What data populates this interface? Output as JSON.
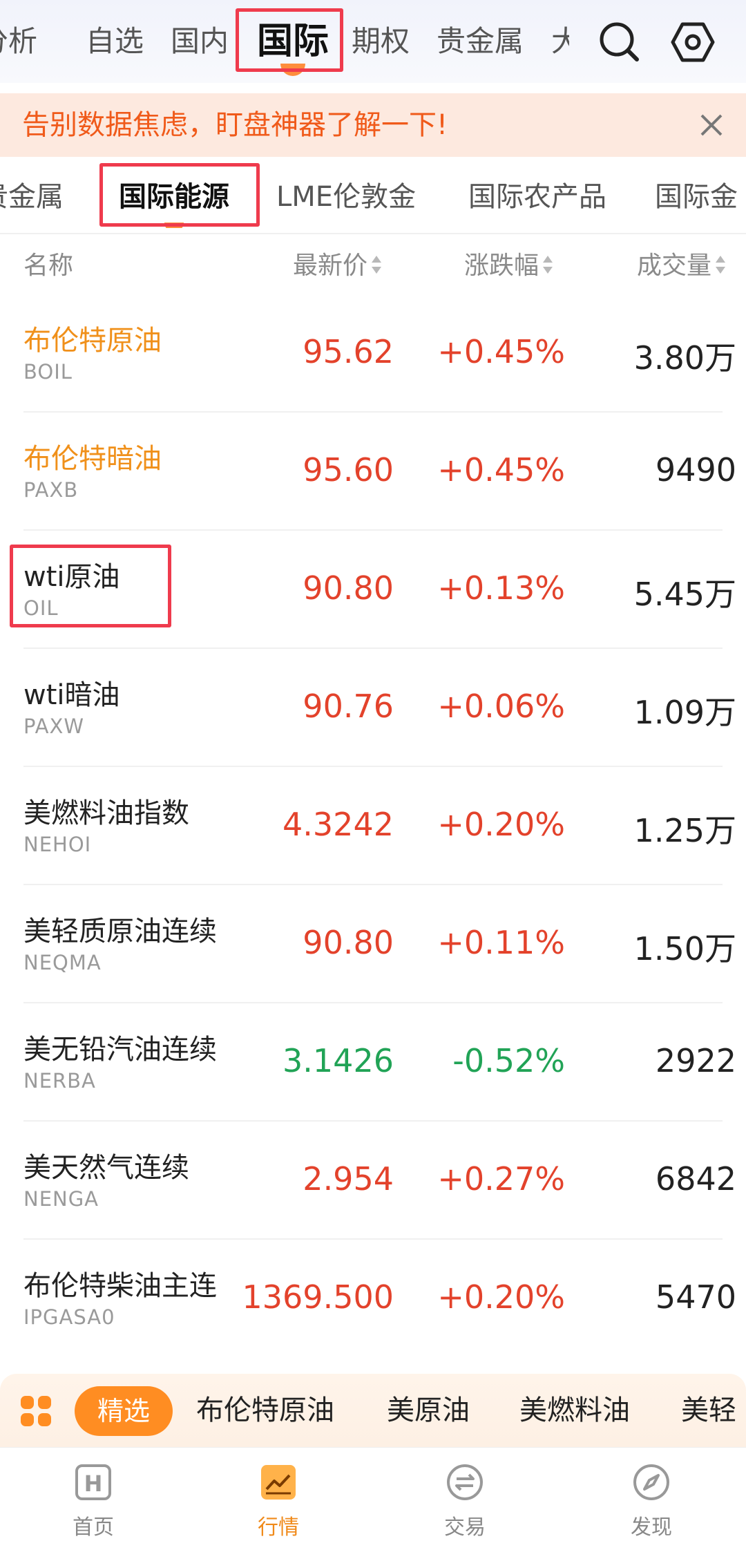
{
  "top_tabs": [
    {
      "label": "分析"
    },
    {
      "label": "自选"
    },
    {
      "label": "国内"
    },
    {
      "label": "国际"
    },
    {
      "label": "期权"
    },
    {
      "label": "贵金属"
    },
    {
      "label": "大"
    }
  ],
  "top_icons": {
    "search": "search-icon",
    "settings": "settings-icon"
  },
  "banner": {
    "text": "告别数据焦虑，盯盘神器了解一下!"
  },
  "sub_tabs": [
    {
      "label": "贵金属"
    },
    {
      "label": "国际能源"
    },
    {
      "label": "LME伦敦金"
    },
    {
      "label": "国际农产品"
    },
    {
      "label": "国际金"
    }
  ],
  "table": {
    "headers": {
      "name": "名称",
      "price": "最新价",
      "change": "涨跌幅",
      "volume": "成交量"
    },
    "rows": [
      {
        "name": "布伦特原油",
        "code": "BOIL",
        "price": "95.62",
        "change": "+0.45%",
        "volume": "3.80万"
      },
      {
        "name": "布伦特暗油",
        "code": "PAXB",
        "price": "95.60",
        "change": "+0.45%",
        "volume": "9490"
      },
      {
        "name": "wti原油",
        "code": "OIL",
        "price": "90.80",
        "change": "+0.13%",
        "volume": "5.45万"
      },
      {
        "name": "wti暗油",
        "code": "PAXW",
        "price": "90.76",
        "change": "+0.06%",
        "volume": "1.09万"
      },
      {
        "name": "美燃料油指数",
        "code": "NEHOI",
        "price": "4.3242",
        "change": "+0.20%",
        "volume": "1.25万"
      },
      {
        "name": "美轻质原油连续",
        "code": "NEQMA",
        "price": "90.80",
        "change": "+0.11%",
        "volume": "1.50万"
      },
      {
        "name": "美无铅汽油连续",
        "code": "NERBA",
        "price": "3.1426",
        "change": "-0.52%",
        "volume": "2922"
      },
      {
        "name": "美天然气连续",
        "code": "NENGA",
        "price": "2.954",
        "change": "+0.27%",
        "volume": "6842"
      },
      {
        "name": "布伦特柴油主连",
        "code": "IPGASA0",
        "price": "1369.500",
        "change": "+0.20%",
        "volume": "5470"
      }
    ]
  },
  "quick_bar": {
    "pill": "精选",
    "items": [
      {
        "label": "布伦特原油"
      },
      {
        "label": "美原油"
      },
      {
        "label": "美燃料油"
      },
      {
        "label": "美轻"
      }
    ]
  },
  "bottom_nav": [
    {
      "label": "首页"
    },
    {
      "label": "行情"
    },
    {
      "label": "交易"
    },
    {
      "label": "发现"
    }
  ],
  "colors": {
    "accent": "#ff8d22",
    "up": "#e3422b",
    "down": "#21a356",
    "highlight_box": "#ef3b4d",
    "featured_name": "#f0901a"
  }
}
